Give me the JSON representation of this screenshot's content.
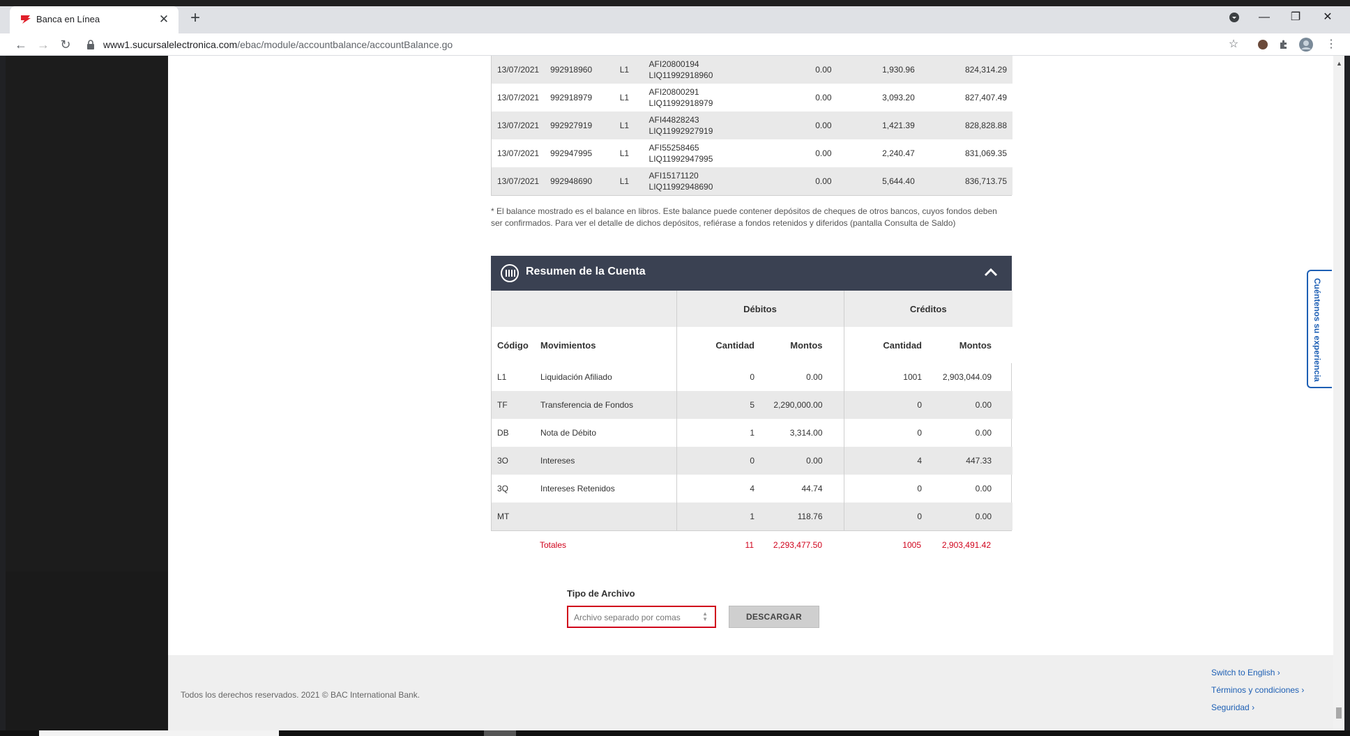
{
  "browser": {
    "tab_title": "Banca en Línea",
    "url_host": "www1.sucursalelectronica.com",
    "url_path": "/ebac/module/accountbalance/accountBalance.go"
  },
  "movements": {
    "rows": [
      {
        "date": "13/07/2021",
        "ref": "992918960",
        "code": "L1",
        "desc1": "AFI20800194",
        "desc2": "LIQ11992918960",
        "debit": "0.00",
        "credit": "1,930.96",
        "balance": "824,314.29"
      },
      {
        "date": "13/07/2021",
        "ref": "992918979",
        "code": "L1",
        "desc1": "AFI20800291",
        "desc2": "LIQ11992918979",
        "debit": "0.00",
        "credit": "3,093.20",
        "balance": "827,407.49"
      },
      {
        "date": "13/07/2021",
        "ref": "992927919",
        "code": "L1",
        "desc1": "AFI44828243",
        "desc2": "LIQ11992927919",
        "debit": "0.00",
        "credit": "1,421.39",
        "balance": "828,828.88"
      },
      {
        "date": "13/07/2021",
        "ref": "992947995",
        "code": "L1",
        "desc1": "AFI55258465",
        "desc2": "LIQ11992947995",
        "debit": "0.00",
        "credit": "2,240.47",
        "balance": "831,069.35"
      },
      {
        "date": "13/07/2021",
        "ref": "992948690",
        "code": "L1",
        "desc1": "AFI15171120",
        "desc2": "LIQ11992948690",
        "debit": "0.00",
        "credit": "5,644.40",
        "balance": "836,713.75"
      }
    ],
    "note": "* El balance mostrado es el balance en libros. Este balance puede contener depósitos de cheques de otros bancos, cuyos fondos deben ser confirmados. Para ver el detalle de dichos depósitos, refiérase a fondos retenidos y diferidos (pantalla Consulta de Saldo)"
  },
  "summary": {
    "title": "Resumen de la Cuenta",
    "group_debits": "Débitos",
    "group_credits": "Créditos",
    "col_code": "Código",
    "col_movements": "Movimientos",
    "col_qty_debit": "Cantidad",
    "col_amount_debit": "Montos",
    "col_qty_credit": "Cantidad",
    "col_amount_credit": "Montos",
    "rows": [
      {
        "code": "L1",
        "name": "Liquidación Afiliado",
        "dqty": "0",
        "damt": "0.00",
        "cqty": "1001",
        "camt": "2,903,044.09"
      },
      {
        "code": "TF",
        "name": "Transferencia de Fondos",
        "dqty": "5",
        "damt": "2,290,000.00",
        "cqty": "0",
        "camt": "0.00"
      },
      {
        "code": "DB",
        "name": "Nota de Débito",
        "dqty": "1",
        "damt": "3,314.00",
        "cqty": "0",
        "camt": "0.00"
      },
      {
        "code": "3O",
        "name": "Intereses",
        "dqty": "0",
        "damt": "0.00",
        "cqty": "4",
        "camt": "447.33"
      },
      {
        "code": "3Q",
        "name": "Intereses Retenidos",
        "dqty": "4",
        "damt": "44.74",
        "cqty": "0",
        "camt": "0.00"
      },
      {
        "code": "MT",
        "name": "",
        "dqty": "1",
        "damt": "118.76",
        "cqty": "0",
        "camt": "0.00"
      }
    ],
    "totals": {
      "label": "Totales",
      "dqty": "11",
      "damt": "2,293,477.50",
      "cqty": "1005",
      "camt": "2,903,491.42"
    }
  },
  "download": {
    "label": "Tipo de Archivo",
    "selected": "Archivo separado por comas",
    "button": "DESCARGAR"
  },
  "feedback": "Cuéntenos su experiencia",
  "footer": {
    "copyright": "Todos los derechos reservados. 2021 © BAC International Bank.",
    "links": [
      "Switch to English",
      "Términos y condiciones",
      "Seguridad"
    ]
  },
  "colors": {
    "header_bg": "#3a4152",
    "accent_red": "#d0021b",
    "link_blue": "#1d5fb4"
  }
}
